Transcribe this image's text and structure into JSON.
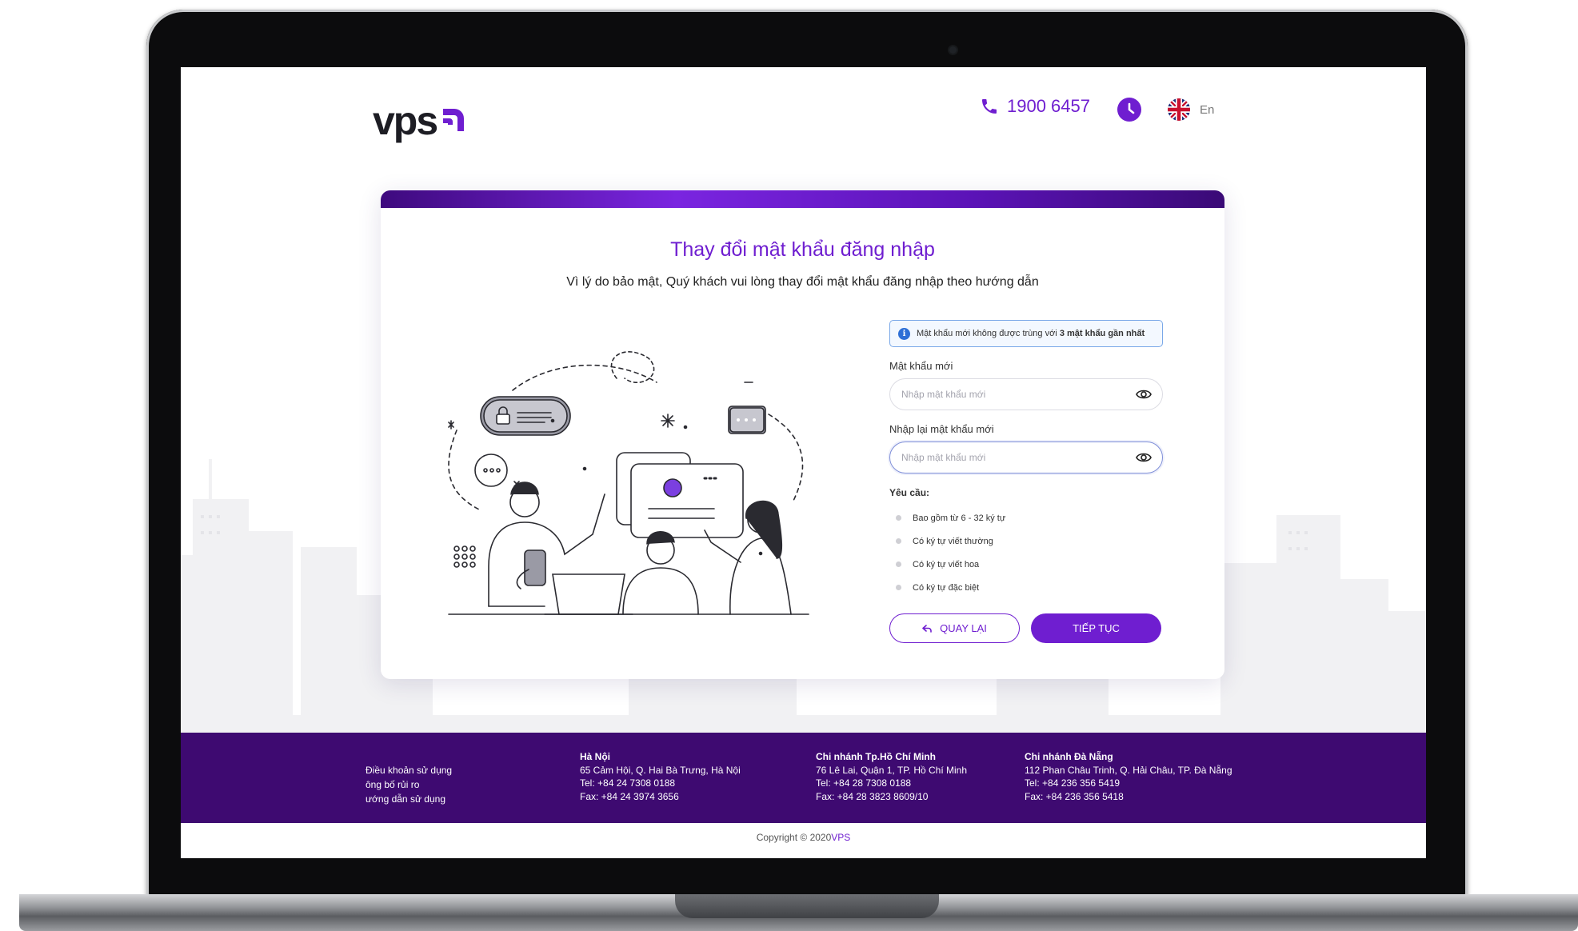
{
  "header": {
    "logo_text": "vps",
    "hotline": "1900 6457",
    "language": "En"
  },
  "card": {
    "title": "Thay đổi mật khẩu đăng nhập",
    "subtitle": "Vì lý do bảo mật, Quý khách vui lòng thay đổi mật khẩu đăng nhập theo hướng dẫn"
  },
  "form": {
    "notice_prefix": "Mật khẩu mới không được trùng với",
    "notice_bold": "3 mật khẩu gần nhất",
    "new_password_label": "Mật khẩu mới",
    "new_password_placeholder": "Nhập mật khẩu mới",
    "confirm_password_label": "Nhập lại mật khẩu mới",
    "confirm_password_placeholder": "Nhập mật khẩu mới",
    "requirements_title": "Yêu cầu:",
    "requirements": [
      "Bao gồm từ 6 - 32 ký tự",
      "Có ký tự viết thường",
      "Có ký tự viết hoa",
      "Có ký tự đặc biệt"
    ],
    "back_button": "QUAY LẠI",
    "continue_button": "TIẾP TỤC"
  },
  "footer": {
    "links": [
      "Điều khoản sử dụng",
      "ông bố rủi ro",
      "ướng dẫn sử dụng"
    ],
    "branches": [
      {
        "name": "Hà Nội",
        "address": "65 Cảm Hội, Q. Hai Bà Trưng, Hà Nội",
        "tel": "Tel: +84 24 7308 0188",
        "fax": "Fax: +84 24 3974 3656"
      },
      {
        "name": "Chi nhánh Tp.Hồ Chí Minh",
        "address": "76 Lê Lai, Quận 1, TP. Hồ Chí Minh",
        "tel": "Tel: +84 28 7308 0188",
        "fax": "Fax: +84 28 3823 8609/10"
      },
      {
        "name": "Chi nhánh Đà Nẵng",
        "address": "112 Phan Châu Trinh, Q. Hải Châu, TP. Đà Nẵng",
        "tel": "Tel: +84 236 356 5419",
        "fax": "Fax: +84 236 356 5418"
      }
    ],
    "copyright_prefix": "Copyright © 2020",
    "copyright_brand": "VPS"
  },
  "colors": {
    "brand_purple": "#6f1ed0",
    "footer_purple": "#3e0a71",
    "notice_border": "#7aa8e8"
  },
  "icons": [
    "phone-icon",
    "clock-icon",
    "uk-flag-icon",
    "info-icon",
    "eye-icon",
    "back-arrow-icon"
  ]
}
